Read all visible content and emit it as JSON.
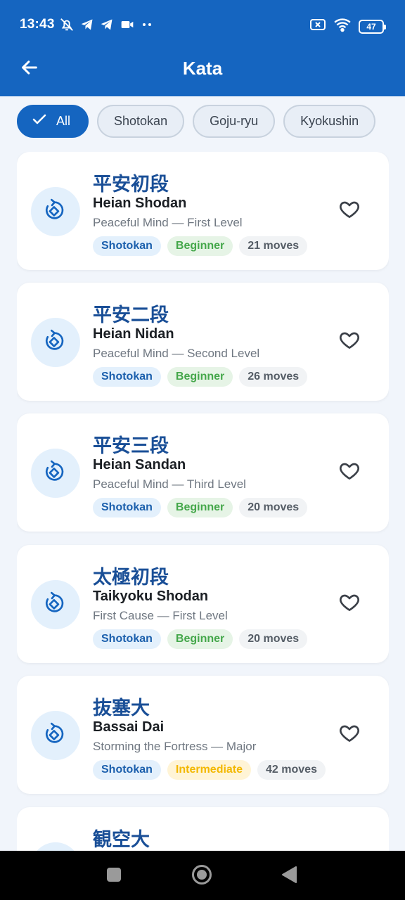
{
  "status_bar": {
    "time": "13:43",
    "battery_level": "47",
    "icons": [
      "mute-icon",
      "telegram-icon",
      "telegram-icon",
      "video-icon",
      "more-dots-icon",
      "sim-icon",
      "wifi-icon",
      "battery-icon"
    ]
  },
  "header": {
    "title": "Kata",
    "back_icon": "arrow-left-icon",
    "accent_color": "#1565c0"
  },
  "filters": {
    "selected": "All",
    "chips": [
      {
        "label": "All"
      },
      {
        "label": "Shotokan"
      },
      {
        "label": "Goju-ryu"
      },
      {
        "label": "Kyokushin"
      }
    ]
  },
  "kata_list": [
    {
      "kanji": "平安初段",
      "name": "Heian Shodan",
      "meaning": "Peaceful Mind — First Level",
      "style": "Shotokan",
      "level": "Beginner",
      "moves": "21 moves",
      "favorite": false
    },
    {
      "kanji": "平安二段",
      "name": "Heian Nidan",
      "meaning": "Peaceful Mind — Second Level",
      "style": "Shotokan",
      "level": "Beginner",
      "moves": "26 moves",
      "favorite": false
    },
    {
      "kanji": "平安三段",
      "name": "Heian Sandan",
      "meaning": "Peaceful Mind — Third Level",
      "style": "Shotokan",
      "level": "Beginner",
      "moves": "20 moves",
      "favorite": false
    },
    {
      "kanji": "太極初段",
      "name": "Taikyoku Shodan",
      "meaning": "First Cause — First Level",
      "style": "Shotokan",
      "level": "Beginner",
      "moves": "20 moves",
      "favorite": false
    },
    {
      "kanji": "抜塞大",
      "name": "Bassai Dai",
      "meaning": "Storming the Fortress — Major",
      "style": "Shotokan",
      "level": "Intermediate",
      "moves": "42 moves",
      "favorite": false
    },
    {
      "kanji": "観空大",
      "name": "",
      "meaning": "",
      "style": "",
      "level": "",
      "moves": "",
      "favorite": false
    }
  ],
  "level_colors": {
    "Beginner": "#44a74a",
    "Intermediate": "#f3b800"
  },
  "nav_bar": {
    "buttons": [
      "recents-square-icon",
      "home-circle-icon",
      "back-triangle-icon"
    ]
  }
}
